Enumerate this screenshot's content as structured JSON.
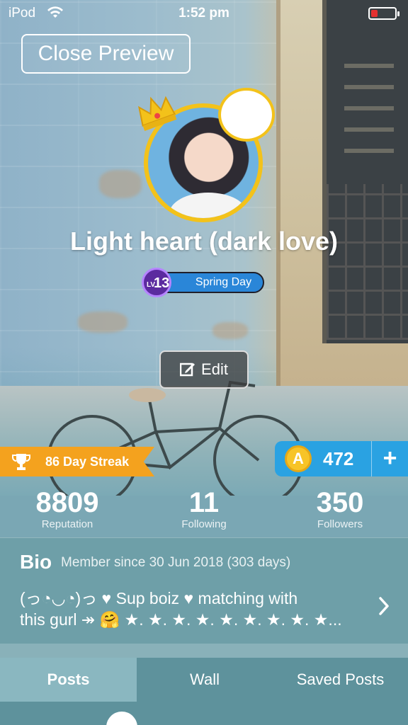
{
  "status_bar": {
    "carrier": "iPod",
    "time": "1:52 pm",
    "battery_color": "#e53030"
  },
  "header": {
    "close_preview_label": "Close Preview"
  },
  "profile": {
    "username": "Light heart (dark love)",
    "level_prefix": "LV",
    "level_number": "13",
    "level_title": "Spring Day",
    "avatar_frame_color": "#f3c21a",
    "crown_icon": "crown-icon",
    "status_emoji": "😰",
    "edit_label": "Edit"
  },
  "streak": {
    "label": "86 Day Streak",
    "color": "#f4a21e"
  },
  "coins": {
    "symbol": "A",
    "amount": "472",
    "add_label": "+",
    "color": "#2aa2e2"
  },
  "stats": [
    {
      "value": "8809",
      "label": "Reputation"
    },
    {
      "value": "11",
      "label": "Following"
    },
    {
      "value": "350",
      "label": "Followers"
    }
  ],
  "bio": {
    "title": "Bio",
    "member_since": "Member since 30 Jun 2018 (303 days)",
    "line1": "(っ◔◡◔)っ ♥ Sup boiz ♥ matching with",
    "line2": "this gurl ↠ 🤗 ★. ★. ★. ★. ★. ★. ★. ★. ★..."
  },
  "tabs": [
    {
      "label": "Posts",
      "active": true
    },
    {
      "label": "Wall",
      "active": false
    },
    {
      "label": "Saved Posts",
      "active": false
    }
  ]
}
